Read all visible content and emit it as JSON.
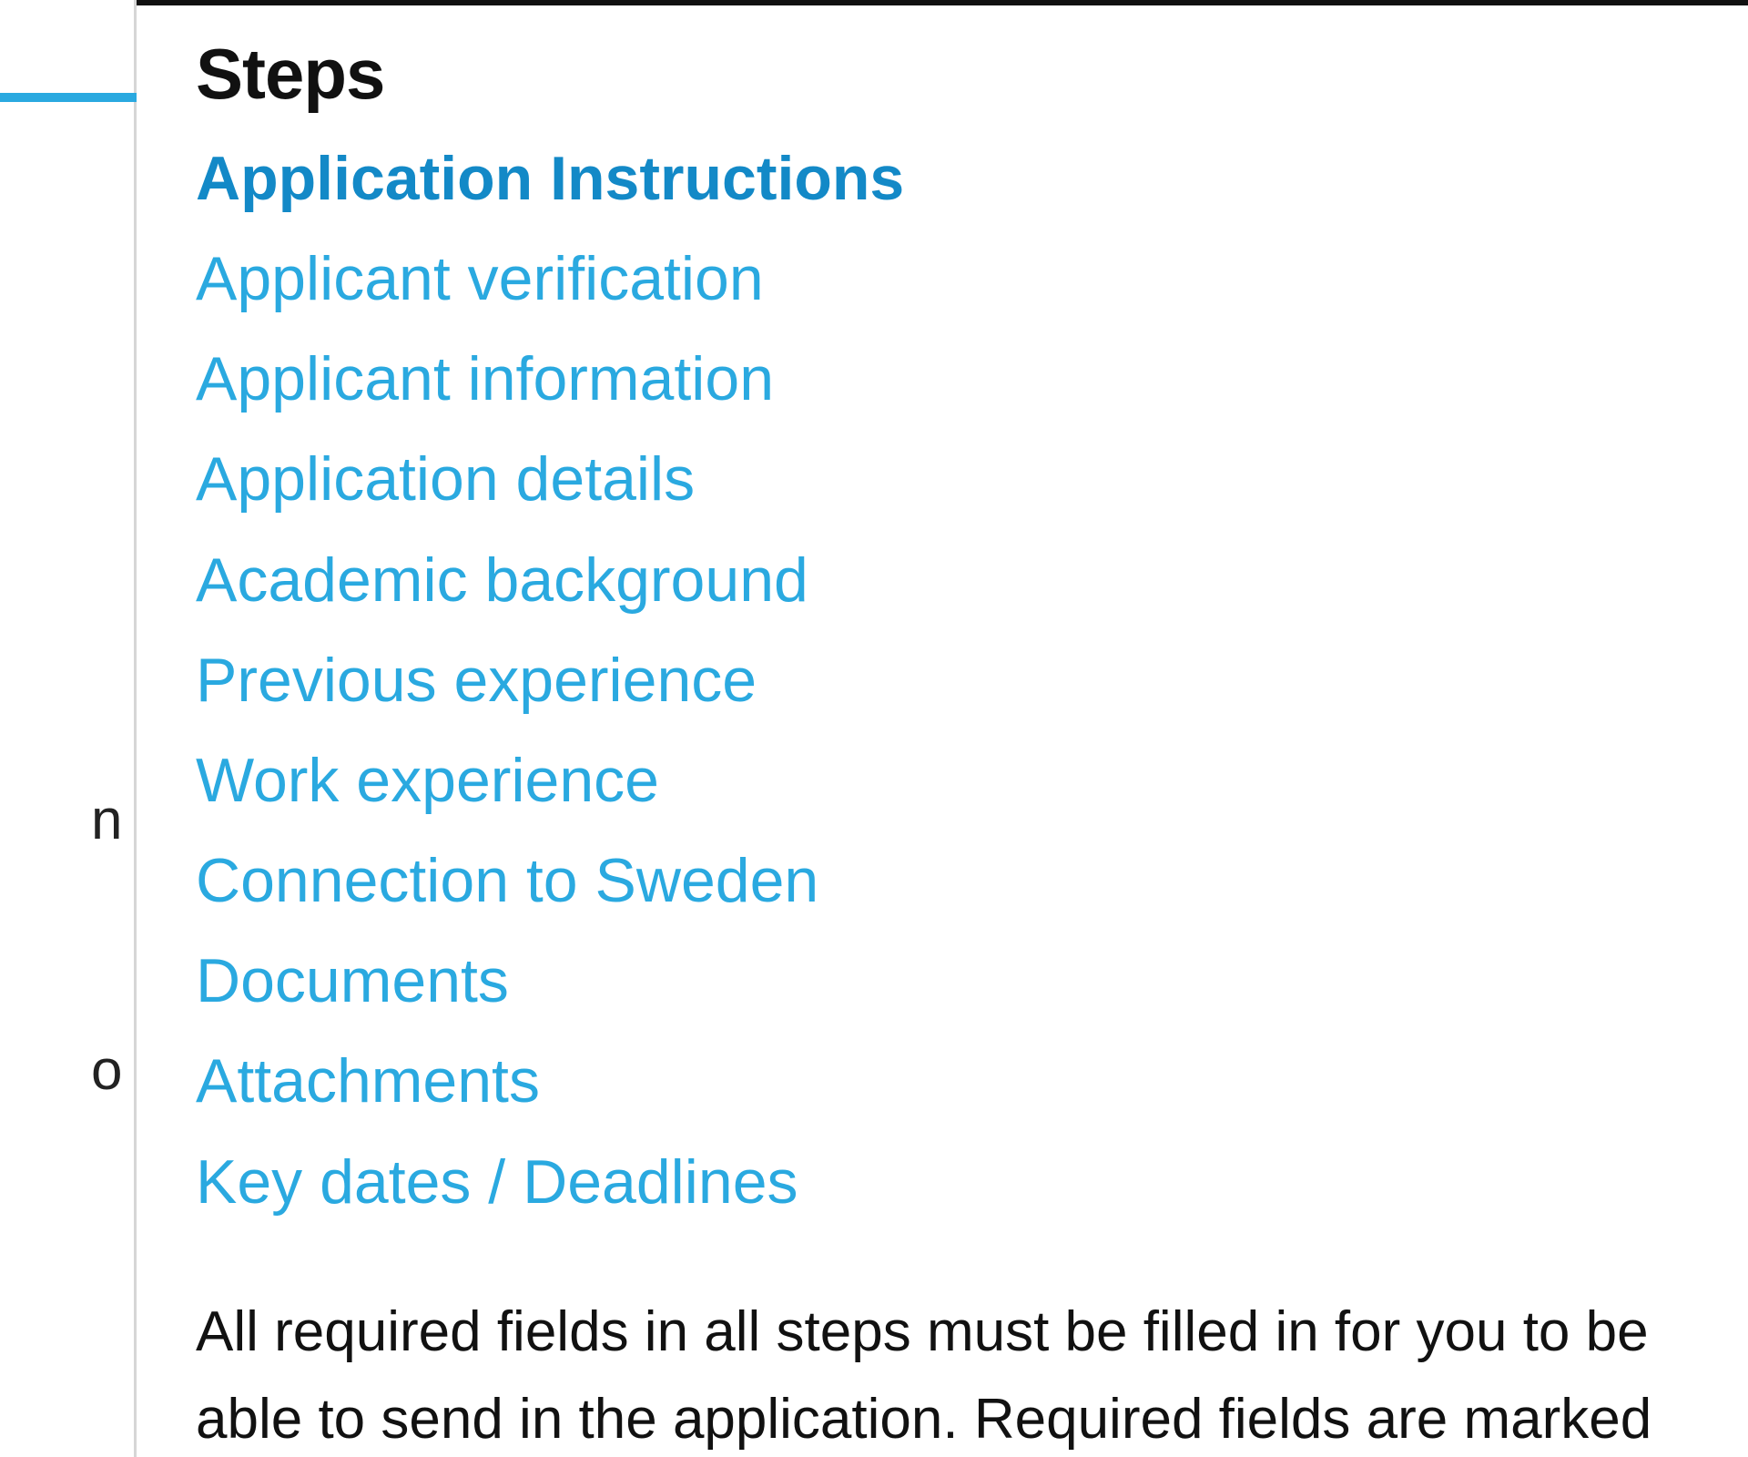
{
  "steps": {
    "heading": "Steps",
    "items": [
      {
        "label": "Application Instructions"
      },
      {
        "label": "Applicant verification"
      },
      {
        "label": "Applicant information"
      },
      {
        "label": "Application details"
      },
      {
        "label": "Academic background"
      },
      {
        "label": "Previous experience"
      },
      {
        "label": "Work experience"
      },
      {
        "label": "Connection to Sweden"
      },
      {
        "label": "Documents"
      },
      {
        "label": "Attachments"
      },
      {
        "label": "Key dates / Deadlines"
      }
    ],
    "info": "All required fields in all steps must be filled in for you to be able to send in the application. Required fields are marked"
  },
  "left_fragments": {
    "f1": "n",
    "f2": "o"
  }
}
